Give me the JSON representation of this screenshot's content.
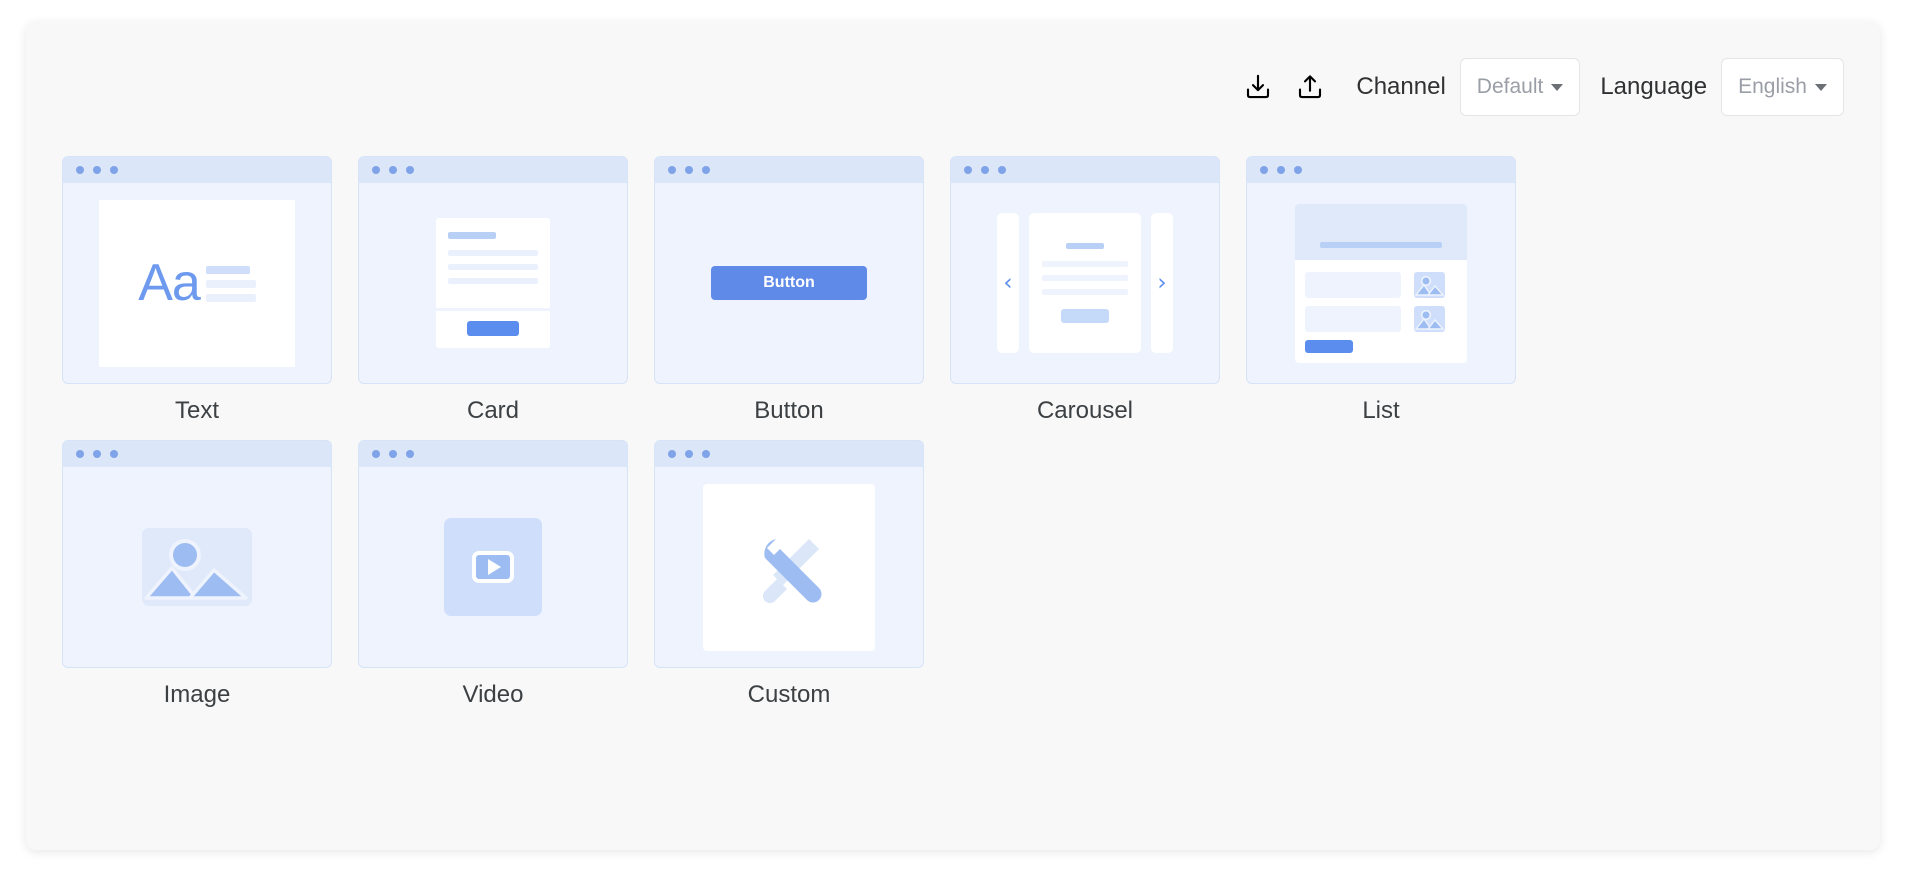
{
  "toolbar": {
    "download_icon": "download-icon",
    "upload_icon": "upload-icon",
    "channel_label": "Channel",
    "channel_value": "Default",
    "language_label": "Language",
    "language_value": "English"
  },
  "components": [
    {
      "label": "Text",
      "preview": "text-preview",
      "button_text": ""
    },
    {
      "label": "Card",
      "preview": "card-preview",
      "button_text": ""
    },
    {
      "label": "Button",
      "preview": "button-preview",
      "button_text": "Button"
    },
    {
      "label": "Carousel",
      "preview": "carousel-preview",
      "button_text": ""
    },
    {
      "label": "List",
      "preview": "list-preview",
      "button_text": ""
    },
    {
      "label": "Image",
      "preview": "image-preview",
      "button_text": ""
    },
    {
      "label": "Video",
      "preview": "video-preview",
      "button_text": ""
    },
    {
      "label": "Custom",
      "preview": "custom-preview",
      "button_text": ""
    }
  ],
  "text_tile": {
    "sample": "Aa"
  },
  "carousel": {
    "prev_glyph": "‹",
    "next_glyph": "›"
  },
  "colors": {
    "accent": "#5b8def",
    "tile_bg": "#eef3fd",
    "tile_bar": "#dbe6f8",
    "panel_bg": "#f8f8f8",
    "label_text": "#3c4043"
  }
}
